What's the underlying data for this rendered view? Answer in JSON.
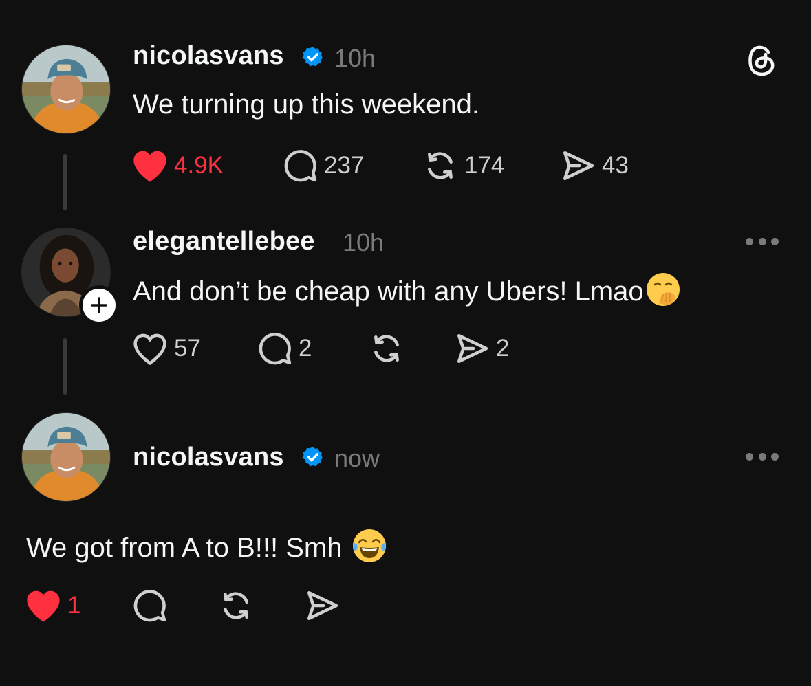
{
  "posts": [
    {
      "username": "nicolasvans",
      "verified": true,
      "time": "10h",
      "text": "We turning up this weekend.",
      "liked": true,
      "likes": "4.9K",
      "replies": "237",
      "reposts": "174",
      "shares": "43"
    },
    {
      "username": "elegantellebee",
      "verified": false,
      "time": "10h",
      "text": "And don’t be cheap with any Ubers! Lmao",
      "emoji": "face-with-hand-over-mouth",
      "liked": false,
      "likes": "57",
      "replies": "2",
      "reposts": "",
      "shares": "2"
    },
    {
      "username": "nicolasvans",
      "verified": true,
      "time": "now",
      "text": "We got from A to B!!! Smh",
      "emoji": "face-with-tears-of-joy",
      "liked": true,
      "likes": "1",
      "replies": "",
      "reposts": "",
      "shares": ""
    }
  ],
  "icons": {
    "app_logo": "threads-logo-icon",
    "like": "heart-icon",
    "reply": "speech-bubble-icon",
    "repost": "repost-icon",
    "share": "send-icon",
    "more": "more-options-icon",
    "verified": "verified-badge-icon",
    "follow": "plus-icon"
  },
  "colors": {
    "background": "#101010",
    "liked": "#ff3040",
    "verified": "#0095f6",
    "secondary_text": "#7a7a7a",
    "thread_line": "#3a3a3a"
  }
}
